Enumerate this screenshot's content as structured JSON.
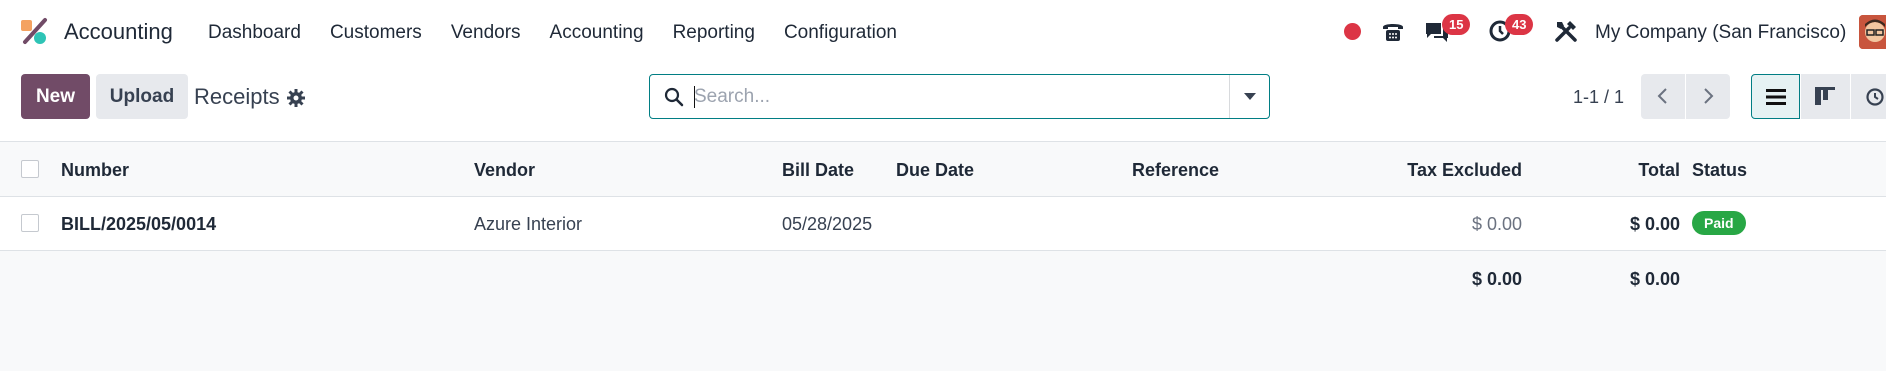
{
  "app": {
    "name": "Accounting"
  },
  "menu": [
    "Dashboard",
    "Customers",
    "Vendors",
    "Accounting",
    "Reporting",
    "Configuration"
  ],
  "systray": {
    "messages_badge": "15",
    "activities_badge": "43",
    "company": "My Company (San Francisco)"
  },
  "control_panel": {
    "new_label": "New",
    "upload_label": "Upload",
    "title": "Receipts",
    "search_placeholder": "Search...",
    "pager": "1-1 / 1"
  },
  "table": {
    "columns": [
      "Number",
      "Vendor",
      "Bill Date",
      "Due Date",
      "Reference",
      "Tax Excluded",
      "Total",
      "Status"
    ],
    "rows": [
      {
        "number": "BILL/2025/05/0014",
        "vendor": "Azure Interior",
        "bill_date": "05/28/2025",
        "due_date": "",
        "reference": "",
        "tax_excluded": "$ 0.00",
        "total": "$ 0.00",
        "status": "Paid"
      }
    ],
    "footer": {
      "tax_excluded": "$ 0.00",
      "total": "$ 0.00"
    }
  },
  "colors": {
    "brand": "#714b67",
    "accent": "#017e84",
    "danger": "#dc3545",
    "success": "#28a745"
  }
}
